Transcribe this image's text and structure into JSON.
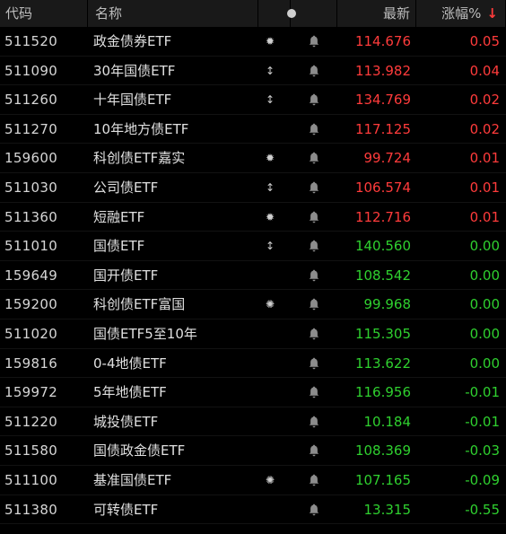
{
  "colors": {
    "up": "#ff3b3b",
    "down": "#2fd02f",
    "background": "#000000",
    "header_bg": "#191919"
  },
  "header": {
    "code": "代码",
    "name": "名称",
    "last": "最新",
    "change": "涨幅%",
    "sort_arrow": "↓",
    "dot_icon": "dot-icon"
  },
  "rows": [
    {
      "code": "511520",
      "name": "政金债券ETF",
      "flag": "✹",
      "flag_icon": "margin-marker-icon",
      "bell": "bell-icon",
      "last": "114.676",
      "change": "0.05",
      "dir": "up"
    },
    {
      "code": "511090",
      "name": "30年国债ETF",
      "flag": "↕",
      "flag_icon": "updown-arrow-icon",
      "bell": "bell-icon",
      "last": "113.982",
      "change": "0.04",
      "dir": "up"
    },
    {
      "code": "511260",
      "name": "十年国债ETF",
      "flag": "↕",
      "flag_icon": "updown-arrow-icon",
      "bell": "bell-icon",
      "last": "134.769",
      "change": "0.02",
      "dir": "up"
    },
    {
      "code": "511270",
      "name": "10年地方债ETF",
      "flag": "",
      "flag_icon": "",
      "bell": "bell-icon",
      "last": "117.125",
      "change": "0.02",
      "dir": "up"
    },
    {
      "code": "159600",
      "name": "科创债ETF嘉实",
      "flag": "✹",
      "flag_icon": "margin-marker-icon",
      "bell": "bell-icon",
      "last": "99.724",
      "change": "0.01",
      "dir": "up"
    },
    {
      "code": "511030",
      "name": "公司债ETF",
      "flag": "↕",
      "flag_icon": "updown-arrow-icon",
      "bell": "bell-icon",
      "last": "106.574",
      "change": "0.01",
      "dir": "up"
    },
    {
      "code": "511360",
      "name": "短融ETF",
      "flag": "✹",
      "flag_icon": "margin-marker-icon",
      "bell": "bell-icon",
      "last": "112.716",
      "change": "0.01",
      "dir": "up"
    },
    {
      "code": "511010",
      "name": "国债ETF",
      "flag": "↕",
      "flag_icon": "updown-arrow-icon",
      "bell": "bell-icon",
      "last": "140.560",
      "change": "0.00",
      "dir": "flat"
    },
    {
      "code": "159649",
      "name": "国开债ETF",
      "flag": "",
      "flag_icon": "",
      "bell": "bell-icon",
      "last": "108.542",
      "change": "0.00",
      "dir": "flat"
    },
    {
      "code": "159200",
      "name": "科创债ETF富国",
      "flag": "✺",
      "flag_icon": "sun-marker-icon",
      "bell": "bell-icon",
      "last": "99.968",
      "change": "0.00",
      "dir": "flat"
    },
    {
      "code": "511020",
      "name": "国债ETF5至10年",
      "flag": "",
      "flag_icon": "",
      "bell": "bell-icon",
      "last": "115.305",
      "change": "0.00",
      "dir": "flat"
    },
    {
      "code": "159816",
      "name": "0-4地债ETF",
      "flag": "",
      "flag_icon": "",
      "bell": "bell-icon",
      "last": "113.622",
      "change": "0.00",
      "dir": "flat"
    },
    {
      "code": "159972",
      "name": "5年地债ETF",
      "flag": "",
      "flag_icon": "",
      "bell": "bell-icon",
      "last": "116.956",
      "change": "-0.01",
      "dir": "down"
    },
    {
      "code": "511220",
      "name": "城投债ETF",
      "flag": "",
      "flag_icon": "",
      "bell": "bell-icon",
      "last": "10.184",
      "change": "-0.01",
      "dir": "down"
    },
    {
      "code": "511580",
      "name": "国债政金债ETF",
      "flag": "",
      "flag_icon": "",
      "bell": "bell-icon",
      "last": "108.369",
      "change": "-0.03",
      "dir": "down"
    },
    {
      "code": "511100",
      "name": "基准国债ETF",
      "flag": "✺",
      "flag_icon": "sun-marker-icon",
      "bell": "bell-icon",
      "last": "107.165",
      "change": "-0.09",
      "dir": "down"
    },
    {
      "code": "511380",
      "name": "可转债ETF",
      "flag": "",
      "flag_icon": "",
      "bell": "bell-icon",
      "last": "13.315",
      "change": "-0.55",
      "dir": "down"
    }
  ]
}
